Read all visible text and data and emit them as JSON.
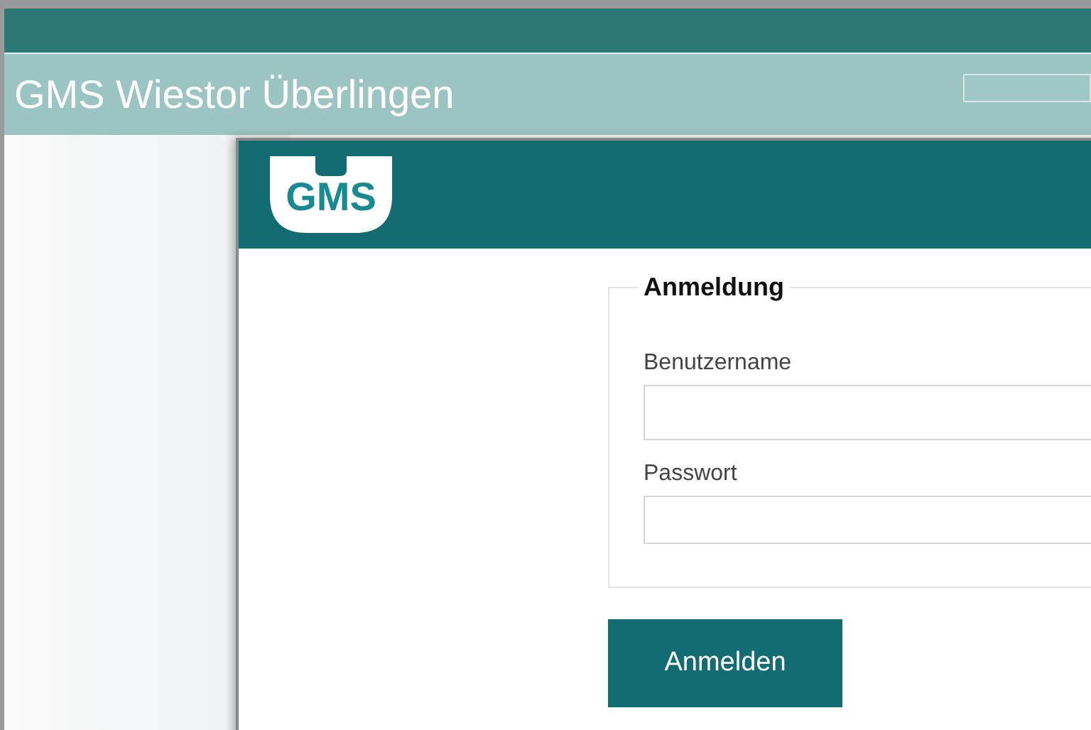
{
  "app_header": {
    "title": "GMS Wiestor Überlingen"
  },
  "dialog": {
    "logo_text": "GMS",
    "legend": "Anmeldung",
    "fields": [
      {
        "label": "Benutzername",
        "kind": "text"
      },
      {
        "label": "Passwort",
        "kind": "password"
      }
    ],
    "submit_button": "Anmelden"
  }
}
